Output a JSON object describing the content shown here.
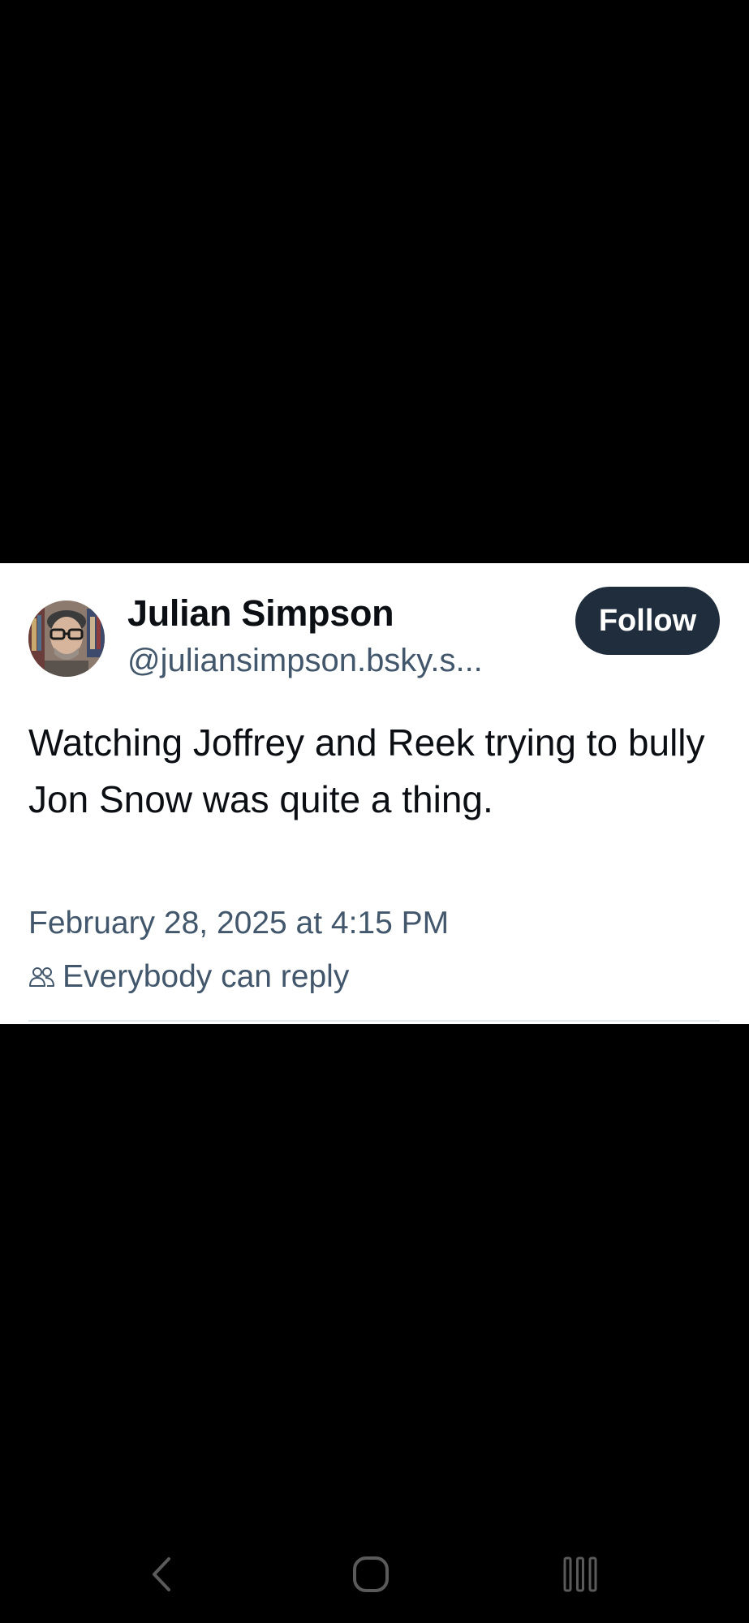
{
  "post": {
    "author": {
      "display_name": "Julian Simpson",
      "handle": "@juliansimpson.bsky.s..."
    },
    "follow_label": "Follow",
    "text": "Watching Joffrey and Reek trying to bully Jon Snow was quite a thing.",
    "timestamp": "February 28, 2025 at 4:15 PM",
    "reply_setting": "Everybody can reply"
  },
  "navigation": {
    "buttons": [
      "back-icon",
      "home-icon",
      "recents-icon"
    ]
  },
  "colors": {
    "background": "#000000",
    "card": "#ffffff",
    "text_primary": "#0b0f14",
    "text_secondary": "#42576c",
    "follow_button": "#1f2d3d",
    "nav_icon": "#5a5a5a"
  }
}
